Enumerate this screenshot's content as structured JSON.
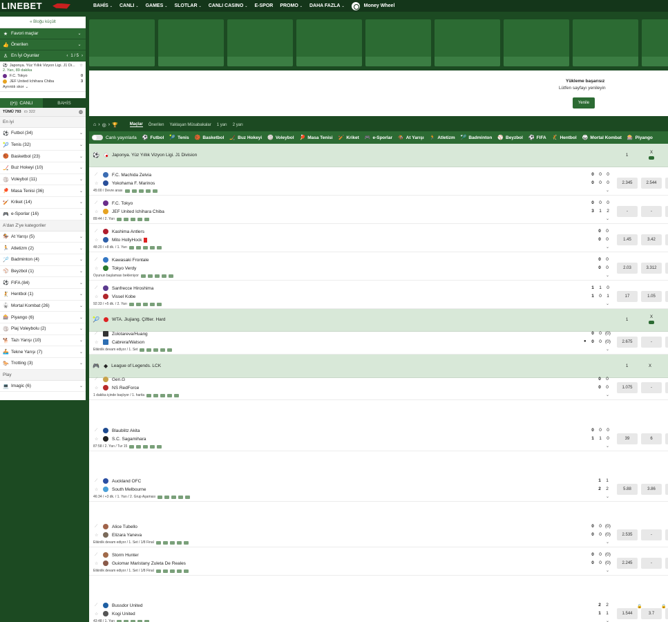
{
  "brand": {
    "logo_text": "LINEBET"
  },
  "nav": [
    {
      "label": "BAHİS",
      "chevron": true
    },
    {
      "label": "CANLI",
      "chevron": true
    },
    {
      "label": "GAMES",
      "chevron": true
    },
    {
      "label": "SLOTLAR",
      "chevron": true
    },
    {
      "label": "CANLI CASINO",
      "chevron": true
    },
    {
      "label": "E-SPOR",
      "chevron": false
    },
    {
      "label": "PROMO",
      "chevron": true
    },
    {
      "label": "DAHA FAZLA",
      "chevron": true
    },
    {
      "label": "Money Wheel",
      "chevron": false
    }
  ],
  "sidebar": {
    "collapse_label": "« Bloğu küçült",
    "favorites": "Favori maçlar",
    "recommended": "Önerilen",
    "top_games": "En İyi Oyunlar",
    "top_pager": "1 / 5",
    "top_game": {
      "league": "Japonya. Yüz Yıllık Vizyon Ligi. J1 Di...",
      "time": "2. Yarı, 89 dakika",
      "team1": "F.C. Tokyo",
      "score1": "0",
      "team2": "JEF United Ichihara Chiba",
      "score2": "3",
      "details": "Ayrıntılı skor"
    },
    "tabs": [
      "CANLI",
      "BAHİS"
    ],
    "all_label": "TÜMÜ 793",
    "all_count": "322",
    "section_best": "En iyi",
    "best_sports": [
      {
        "icon": "⚽",
        "label": "Futbol (34)"
      },
      {
        "icon": "🎾",
        "label": "Tenis (32)"
      },
      {
        "icon": "🏀",
        "label": "Basketbol (23)"
      },
      {
        "icon": "🏒",
        "label": "Buz Hokeyi (10)"
      },
      {
        "icon": "🏐",
        "label": "Voleybol (11)"
      },
      {
        "icon": "🏓",
        "label": "Masa Tenisi (36)"
      },
      {
        "icon": "🏏",
        "label": "Kriket (14)"
      },
      {
        "icon": "🎮",
        "label": "e-Sporlar (16)"
      }
    ],
    "section_az": "A'dan Z'ye kategoriler",
    "az_sports": [
      {
        "icon": "🏇",
        "label": "At Yarışı (5)"
      },
      {
        "icon": "🏃",
        "label": "Atletizm (2)"
      },
      {
        "icon": "🏸",
        "label": "Badminton (4)"
      },
      {
        "icon": "⚾",
        "label": "Beyzbol (1)"
      },
      {
        "icon": "⚽",
        "label": "FIFA (84)"
      },
      {
        "icon": "🤾",
        "label": "Hentbol (1)"
      },
      {
        "icon": "🥋",
        "label": "Mortal Kombat (26)"
      },
      {
        "icon": "🎰",
        "label": "Piyango (6)"
      },
      {
        "icon": "🏐",
        "label": "Plaj Voleybolu (2)"
      },
      {
        "icon": "🐕",
        "label": "Tazı Yarışı (10)"
      },
      {
        "icon": "🚣",
        "label": "Tekne Yarışı (7)"
      },
      {
        "icon": "🐎",
        "label": "Trotting (3)"
      }
    ],
    "section_play": "Play",
    "play_sports": [
      {
        "icon": "💻",
        "label": "Imagic (6)"
      }
    ]
  },
  "load_panel": {
    "title": "Yükleme başarısız",
    "subtitle": "Lütfen sayfayı yenileyin",
    "button": "Yenile"
  },
  "breadcrumb": {
    "tabs": [
      "Maçlar",
      "Önerilen",
      "Yaklaşan Müsabakalar",
      "1 yarı",
      "2 yarı"
    ]
  },
  "sport_bar": {
    "toggle_label": "Canlı yayınlarla",
    "sports": [
      {
        "icon": "⚽",
        "label": "Futbol"
      },
      {
        "icon": "🎾",
        "label": "Tenis"
      },
      {
        "icon": "🏀",
        "label": "Basketbol"
      },
      {
        "icon": "🏒",
        "label": "Buz Hokeyi"
      },
      {
        "icon": "🏐",
        "label": "Voleybol"
      },
      {
        "icon": "🏓",
        "label": "Masa Tenisi"
      },
      {
        "icon": "🏏",
        "label": "Kriket"
      },
      {
        "icon": "🎮",
        "label": "e-Sporlar"
      },
      {
        "icon": "🏇",
        "label": "At Yarışı"
      },
      {
        "icon": "🏃",
        "label": "Atletizm"
      },
      {
        "icon": "🏸",
        "label": "Badminton"
      },
      {
        "icon": "⚾",
        "label": "Beyzbol"
      },
      {
        "icon": "⚽",
        "label": "FIFA"
      },
      {
        "icon": "🤾",
        "label": "Hentbol"
      },
      {
        "icon": "🥋",
        "label": "Mortal Kombat"
      },
      {
        "icon": "🎰",
        "label": "Piyango"
      }
    ]
  },
  "leagues": [
    {
      "icon": "⚽",
      "flag": "jp",
      "name": "Japonya. Yüz Yıllık Vizyon Ligi. J1 Division",
      "col1": "1",
      "colx": "X"
    },
    {
      "icon": "🎾",
      "flag": "cn",
      "name": "WTA. Jiujiang. Çiftler. Hard",
      "col1": "1",
      "colx": "X"
    },
    {
      "icon": "🎮",
      "flag": "lol",
      "name": "League of Legends. LCK",
      "col1": "1",
      "colx": "X"
    }
  ],
  "matches": [
    {
      "t1": "F.C. Machida Zelvia",
      "t2": "Yokohama F. Marinos",
      "s1": [
        "0",
        "0",
        "0"
      ],
      "s2": [
        "0",
        "0",
        "0"
      ],
      "info": "45:00 / Devre arası",
      "odds": [
        "2.345",
        "2.544"
      ]
    },
    {
      "t1": "F.C. Tokyo",
      "t2": "JEF United Ichihara Chiba",
      "s1": [
        "0",
        "0",
        "0"
      ],
      "s2": [
        "3",
        "1",
        "2"
      ],
      "info": "89:44 / 2. Yarı",
      "odds": [
        "-",
        "-"
      ]
    },
    {
      "t1": "Kashima Antlers",
      "t2": "Mito HollyHock",
      "s1": [
        "0",
        "0"
      ],
      "s2": [
        "0",
        "0"
      ],
      "info": "48:20 / +8 dk. / 1. Yarı",
      "odds": [
        "1.45",
        "3.42"
      ]
    },
    {
      "t1": "Kawasaki Frontale",
      "t2": "Tokyo Verdy",
      "s1": [
        "0",
        "0"
      ],
      "s2": [
        "0",
        "0"
      ],
      "info": "Oyunun başlaması bekleniyor",
      "odds": [
        "2.03",
        "3.312"
      ]
    },
    {
      "t1": "Sanfrecce Hiroshima",
      "t2": "Vissel Kobe",
      "s1": [
        "1",
        "1",
        "0"
      ],
      "s2": [
        "1",
        "0",
        "1"
      ],
      "info": "92:33 / +5 dk. / 2. Yarı",
      "odds": [
        "17",
        "1.05"
      ]
    },
    {
      "t1": "Zolotareva/Huang",
      "t2": "Cabrera/Watson",
      "s1": [
        "0",
        "0",
        "(0)"
      ],
      "s2": [
        "0",
        "0",
        "(0)"
      ],
      "info": "Etkinlik devam ediyor / 1. Set",
      "odds": [
        "2.675",
        "-"
      ]
    },
    {
      "t1": "Gen.G",
      "t2": "NS RedForce",
      "s1": [
        "0",
        "0"
      ],
      "s2": [
        "0",
        "0"
      ],
      "info": "1 dakika içinde başlıyor / 1. harita",
      "odds": [
        "1.075",
        "-"
      ]
    },
    {
      "t1": "Blaublitz Akita",
      "t2": "S.C. Sagamihara",
      "s1": [
        "0",
        "0",
        "0"
      ],
      "s2": [
        "1",
        "1",
        "0"
      ],
      "info": "87:58 / 2. Yarı / Tur 15",
      "odds": [
        "39",
        "6"
      ]
    },
    {
      "t1": "Auckland OFC",
      "t2": "South Melbourne",
      "s1": [
        "1",
        "1"
      ],
      "s2": [
        "2",
        "2"
      ],
      "info": "46:34 / +3 dk. / 1. Yarı / 2. Grup Aşaması",
      "odds": [
        "5.88",
        "3.86"
      ]
    },
    {
      "t1": "Alice Tubello",
      "t2": "Elizara Yaneva",
      "s1": [
        "0",
        "0",
        "(0)"
      ],
      "s2": [
        "0",
        "0",
        "(0)"
      ],
      "info": "Etkinlik devam ediyor / 1. Set / 1/8 Final",
      "odds": [
        "2.535",
        "-"
      ]
    },
    {
      "t1": "Storm Hunter",
      "t2": "Guiomar Maristany Zuleta De Reales",
      "s1": [
        "0",
        "0",
        "(0)"
      ],
      "s2": [
        "0",
        "0",
        "(0)"
      ],
      "info": "Etkinlik devam ediyor / 1. Set / 1/8 Final",
      "odds": [
        "2.245",
        "-"
      ]
    },
    {
      "t1": "Bussdor United",
      "t2": "Kogi United",
      "s1": [
        "2",
        "2"
      ],
      "s2": [
        "1",
        "1"
      ],
      "info": "43:48 / 1. Yarı",
      "odds": [
        "1.544",
        "3.7"
      ]
    }
  ]
}
